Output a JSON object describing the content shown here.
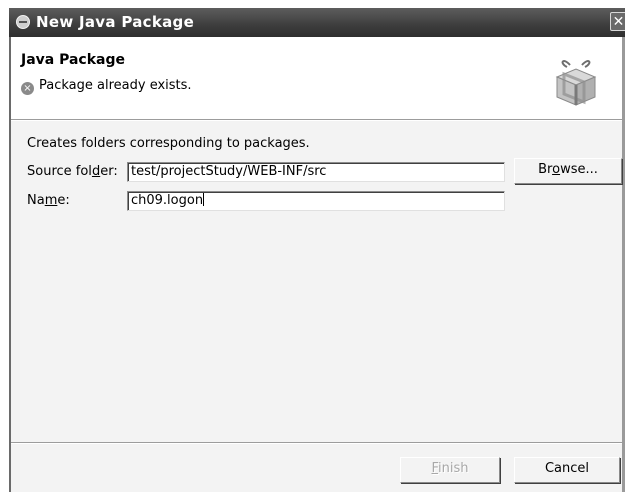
{
  "window": {
    "title": "New Java Package",
    "close_glyph": "✕"
  },
  "header": {
    "title": "Java Package",
    "error_glyph": "×",
    "message": "Package already exists."
  },
  "form": {
    "description": "Creates folders corresponding to packages.",
    "source_folder": {
      "label_pre": "Source fol",
      "label_mnemonic": "d",
      "label_post": "er:",
      "value": "test/projectStudy/WEB-INF/src"
    },
    "name": {
      "label_pre": "Na",
      "label_mnemonic": "m",
      "label_post": "e:",
      "value": "ch09.logon"
    },
    "browse": {
      "pre": "Br",
      "mnemonic": "o",
      "post": "wse..."
    }
  },
  "footer": {
    "finish": {
      "mnemonic": "F",
      "post": "inish",
      "enabled": false
    },
    "cancel_label": "Cancel"
  },
  "icons": {
    "window": "java-app-icon",
    "error": "error-icon",
    "banner": "package-gift-icon"
  }
}
